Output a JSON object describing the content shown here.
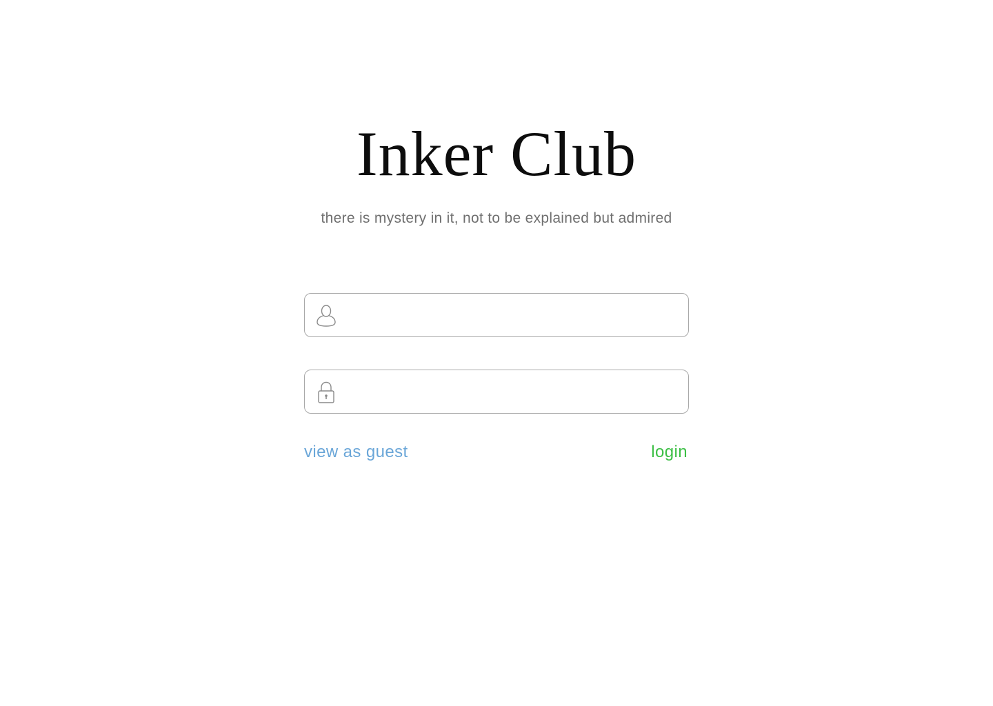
{
  "header": {
    "title": "Inker Club",
    "tagline": "there is mystery in it, not to be explained but admired"
  },
  "form": {
    "username": {
      "icon": "user-icon",
      "value": "",
      "placeholder": ""
    },
    "password": {
      "icon": "lock-icon",
      "value": "",
      "placeholder": ""
    }
  },
  "actions": {
    "guest_label": "view as guest",
    "login_label": "login"
  },
  "colors": {
    "guest_link": "#6aa6d8",
    "login_link": "#3cbf45",
    "field_border": "#a9a9a9",
    "tagline": "#6f6f6f",
    "title": "#0d0d0d"
  }
}
